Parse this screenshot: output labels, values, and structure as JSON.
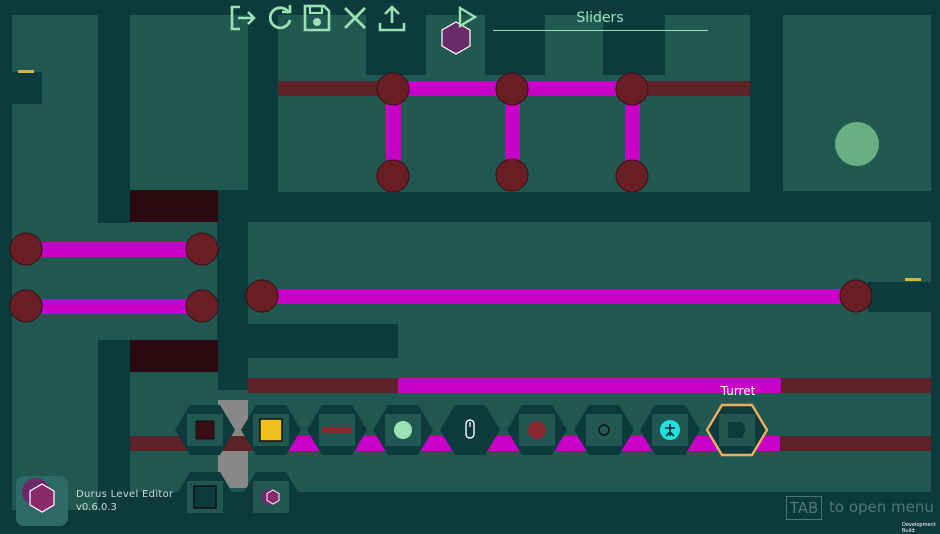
{
  "level_title": "Sliders",
  "toolbar": [
    {
      "name": "exit-icon"
    },
    {
      "name": "reload-icon"
    },
    {
      "name": "save-icon"
    },
    {
      "name": "close-icon"
    },
    {
      "name": "upload-icon"
    },
    {
      "name": "play-icon"
    }
  ],
  "palette": {
    "selected_label": "Turret",
    "items": [
      {
        "name": "block-tool",
        "icon": "dark-red-square-icon"
      },
      {
        "name": "yellow-block-tool",
        "icon": "yellow-square-icon"
      },
      {
        "name": "slider-track-tool",
        "icon": "slider-bar-icon"
      },
      {
        "name": "goal-tool",
        "icon": "green-circle-icon"
      },
      {
        "name": "mouse-tool",
        "icon": "mouse-icon"
      },
      {
        "name": "node-tool",
        "icon": "red-circle-icon"
      },
      {
        "name": "ring-tool",
        "icon": "ring-icon"
      },
      {
        "name": "spawn-tool",
        "icon": "player-icon"
      },
      {
        "name": "turret-tool",
        "icon": "turret-icon"
      },
      {
        "name": "wall-tool",
        "icon": "wall-square-icon"
      },
      {
        "name": "hex-tool",
        "icon": "hexagon-icon"
      }
    ]
  },
  "footer": {
    "app_name": "Durus Level Editor",
    "version": "v0.6.0.3",
    "tab_key": "TAB",
    "tab_hint": "to open menu",
    "dev_note": "Development Build"
  },
  "colors": {
    "background": "#0d3a3c",
    "floor": "#215852",
    "wall": "#0d3a3c",
    "slider_active": "#c800c8",
    "slider_inactive": "#5e2329",
    "node": "#6a1f25",
    "goal": "#6aae83",
    "accent": "#9be3b5",
    "selection": "#f0b060"
  }
}
